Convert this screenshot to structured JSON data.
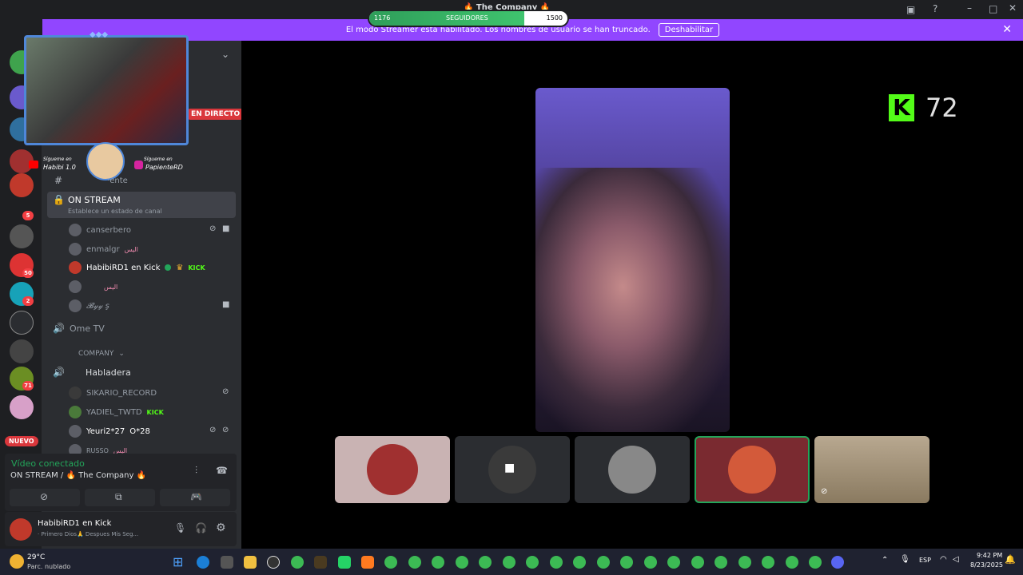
{
  "titlebar": {
    "server_title": "🔥 The Company 🔥",
    "followers": {
      "current": "1176",
      "label": "SEGUIDORES",
      "goal": "1500",
      "progress": 0.784
    },
    "icons": [
      "inbox-icon",
      "help-icon",
      "minimize-icon",
      "maximize-icon",
      "close-icon"
    ]
  },
  "banner": {
    "text": "El modo Streamer está habilitado. Los nombres de usuario se han truncado.",
    "button": "Deshabilitar"
  },
  "overlay": {
    "left_platform": "Sígueme en",
    "left_handle": "Habibi 1.0",
    "right_platform": "Sígueme en",
    "right_handle": "PapienteRD"
  },
  "sidebar": {
    "live_badge": "EN DIRECTO",
    "partial_channel": "·ente",
    "on_stream": {
      "name": "ON STREAM",
      "status": "Establece un estado de canal"
    },
    "members_top": [
      {
        "name": "canserbero",
        "extra": ""
      },
      {
        "name": "enmalgr",
        "extra": "اليس"
      },
      {
        "name": "HabibiRD1 en Kick",
        "extra": "KICK"
      },
      {
        "name": "",
        "extra": "اليس"
      },
      {
        "name": "𝓑𝓎𝓎 ş",
        "extra": ""
      }
    ],
    "voice_channel_1": "Ome TV",
    "category": "COMPANY",
    "voice_channel_2": "Habladera",
    "members_bottom": [
      {
        "name": "SIKARIO_RECORD",
        "extra": ""
      },
      {
        "name": "YADIEL_TWTD",
        "extra": "KICK"
      },
      {
        "name": "Yeuri2*27",
        "extra": "O*28"
      },
      {
        "name": "RUSSO",
        "extra": "اليس"
      }
    ],
    "server_badges": [
      "5",
      "50",
      "2",
      "71"
    ],
    "new_label": "NUEVO"
  },
  "voice": {
    "status": "Vídeo conectado",
    "location": "ON STREAM / 🔥 The Company 🔥"
  },
  "user": {
    "name": "HabibiRD1 en Kick",
    "status": "· Primero Dios🙏 Despues Mis Seg..."
  },
  "stage": {
    "kick_label": "K",
    "kick_count": "72",
    "tiles": [
      "avatar-tile-1",
      "camera-off-tile",
      "avatar-tile-3",
      "selected-tile",
      "room-tile"
    ]
  },
  "taskbar": {
    "weather_temp": "29°C",
    "weather_desc": "Parc. nublado",
    "lang": "ESP",
    "time": "9:42 PM",
    "date": "8/23/2025"
  },
  "colors": {
    "banner": "#9146ff",
    "kick": "#53fc18",
    "live": "#da373c",
    "online": "#23a55a",
    "bg": "#1e1f22",
    "panel": "#2b2d31"
  }
}
